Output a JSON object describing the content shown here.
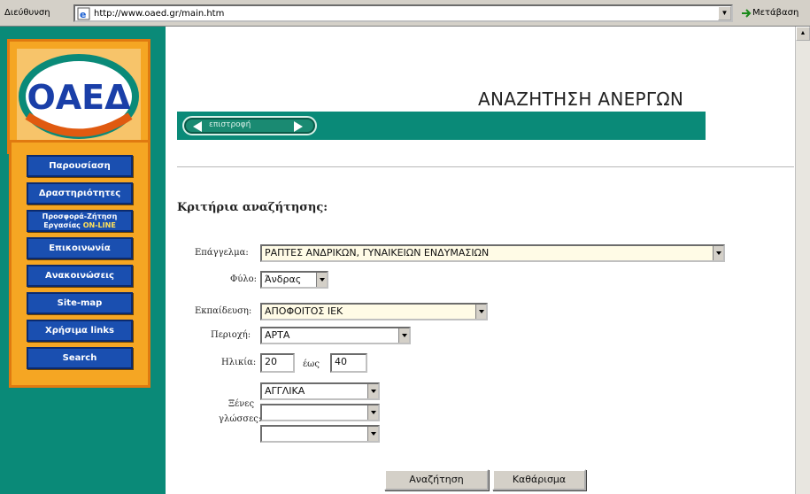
{
  "browser": {
    "address_label": "Διεύθυνση",
    "url": "http://www.oaed.gr/main.htm",
    "go_label": "Μετάβαση"
  },
  "logo": {
    "text": "ΟΑΕΔ"
  },
  "sidebar": {
    "items": [
      {
        "label": "Παρουσίαση"
      },
      {
        "label": "Δραστηριότητες"
      },
      {
        "label_line1": "Προσφορά-Ζήτηση",
        "label_line2": "Εργασίας",
        "label_accent": "ON-LINE"
      },
      {
        "label": "Επικοινωνία"
      },
      {
        "label": "Ανακοινώσεις"
      },
      {
        "label": "Site-map"
      },
      {
        "label": "Χρήσιμα links"
      },
      {
        "label": "Search"
      }
    ]
  },
  "header": {
    "title": "ΑΝΑΖΗΤΗΣΗ ΑΝΕΡΓΩΝ",
    "back_label": "επιστροφή"
  },
  "form": {
    "heading": "Κριτήρια αναζήτησης:",
    "profession": {
      "label": "Επάγγελμα:",
      "value": "ΡΑΠΤΕΣ ΑΝΔΡΙΚΩΝ, ΓΥΝΑΙΚΕΙΩΝ ΕΝΔΥΜΑΣΙΩΝ"
    },
    "gender": {
      "label": "Φύλο:",
      "value": "Άνδρας"
    },
    "education": {
      "label": "Εκπαίδευση:",
      "value": "ΑΠΟΦΟΙΤΟΣ ΙΕΚ"
    },
    "region": {
      "label": "Περιοχή:",
      "value": "ΑΡΤΑ"
    },
    "age": {
      "label": "Ηλικία:",
      "from": "20",
      "to_label": "έως",
      "to": "40"
    },
    "languages": {
      "label_line1": "Ξένες",
      "label_line2": "γλώσσες:",
      "values": [
        "ΑΓΓΛΙΚΑ",
        "",
        ""
      ]
    },
    "search_button": "Αναζήτηση",
    "clear_button": "Καθάρισμα"
  },
  "colors": {
    "brand_teal": "#0a8a78",
    "nav_blue": "#1a4fb0",
    "orange": "#f5a623",
    "logo_blue": "#1a3fa8"
  }
}
